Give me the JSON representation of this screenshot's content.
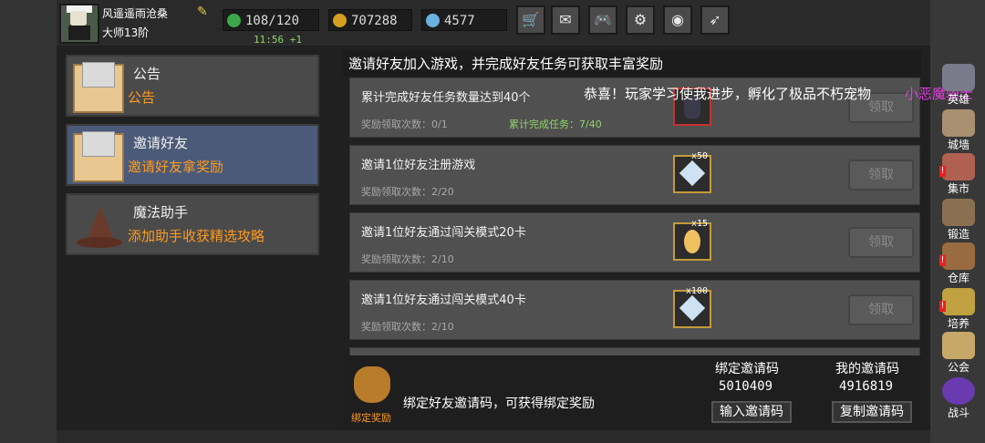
{
  "player": {
    "name": "风遥遥雨沧桑",
    "rank": "大师13阶"
  },
  "resources": {
    "energy": "108/120",
    "timer": "11:56 +1",
    "gold": "707288",
    "gems": "4577"
  },
  "toolbar": [
    {
      "name": "shop-button",
      "icon": "cart-icon",
      "glyph": "🛒"
    },
    {
      "name": "mail-button",
      "icon": "envelope-icon",
      "glyph": "✉"
    },
    {
      "name": "game-button",
      "icon": "gamepad-icon",
      "glyph": "🎮"
    },
    {
      "name": "settings-button",
      "icon": "gear-icon",
      "glyph": "⚙"
    },
    {
      "name": "wheel-button",
      "icon": "color-wheel-icon",
      "glyph": "◉"
    },
    {
      "name": "feather-button",
      "icon": "feather-icon",
      "glyph": "➶"
    }
  ],
  "menu": [
    {
      "title": "公告",
      "subtitle": "公告"
    },
    {
      "title": "邀请好友",
      "subtitle": "邀请好友拿奖励"
    },
    {
      "title": "魔法助手",
      "subtitle": "添加助手收获精选攻略"
    }
  ],
  "panel": {
    "title": "邀请好友加入游戏，并完成好友任务可获取丰富奖励",
    "notice": "恭喜！玩家学习使我进步，孵化了极品不朽宠物",
    "notice_highlight": "小恶魔骑士",
    "tasks": [
      {
        "title": "累计完成好友任务数量达到40个",
        "count": "奖励领取次数：0/1",
        "progress": "累计完成任务：7/40",
        "qty": "",
        "claim": "领取"
      },
      {
        "title": "邀请1位好友注册游戏",
        "count": "奖励领取次数：2/20",
        "progress": "",
        "qty": "x50",
        "claim": "领取"
      },
      {
        "title": "邀请1位好友通过闯关模式20卡",
        "count": "奖励领取次数：2/10",
        "progress": "",
        "qty": "x15",
        "claim": "领取"
      },
      {
        "title": "邀请1位好友通过闯关模式40卡",
        "count": "奖励领取次数：2/10",
        "progress": "",
        "qty": "x100",
        "claim": "领取"
      }
    ]
  },
  "bottom": {
    "bag_label": "绑定奖励",
    "bind_text": "绑定好友邀请码，可获得绑定奖励",
    "bind_code_label": "绑定邀请码",
    "bind_code": "5010409",
    "my_code_label": "我的邀请码",
    "my_code": "4916819",
    "input_button": "输入邀请码",
    "copy_button": "复制邀请码"
  },
  "sidebar": [
    {
      "label": "英雄",
      "icon": "knight-helmet-icon",
      "alert": false
    },
    {
      "label": "城墙",
      "icon": "castle-wall-icon",
      "alert": false
    },
    {
      "label": "集市",
      "icon": "market-icon",
      "alert": true
    },
    {
      "label": "锻造",
      "icon": "anvil-icon",
      "alert": false
    },
    {
      "label": "仓库",
      "icon": "warehouse-icon",
      "alert": true
    },
    {
      "label": "培养",
      "icon": "trophy-icon",
      "alert": true
    },
    {
      "label": "公会",
      "icon": "guild-icon",
      "alert": false
    },
    {
      "label": "战斗",
      "icon": "portal-icon",
      "alert": false
    }
  ],
  "colors": {
    "accent_orange": "#ff9a1e",
    "progress_green": "#8fd46a",
    "selected_menu": "#4a5a78",
    "notice_magenta": "#e040e0"
  }
}
